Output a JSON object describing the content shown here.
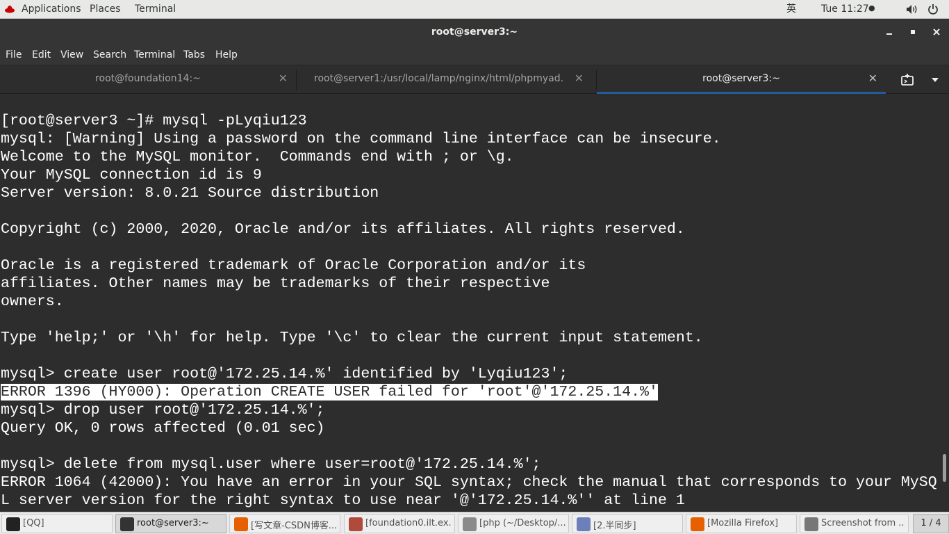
{
  "topbar": {
    "applications": "Applications",
    "places": "Places",
    "terminal": "Terminal",
    "input_method": "英",
    "clock": "Tue 11:27",
    "volume_icon": "speaker-icon",
    "power_icon": "power-icon"
  },
  "window": {
    "title": "root@server3:~",
    "minimize": "—",
    "maximize": "▪",
    "close": "✕"
  },
  "menu": {
    "file": "File",
    "edit": "Edit",
    "view": "View",
    "search": "Search",
    "terminal": "Terminal",
    "tabs": "Tabs",
    "help": "Help"
  },
  "tabs": [
    {
      "label": "root@foundation14:~"
    },
    {
      "label": "root@server1:/usr/local/lamp/nginx/html/phpmyad..."
    },
    {
      "label": "root@server3:~"
    }
  ],
  "terminal_lines": [
    "[root@server3 ~]# mysql -pLyqiu123",
    "mysql: [Warning] Using a password on the command line interface can be insecure.",
    "Welcome to the MySQL monitor.  Commands end with ; or \\g.",
    "Your MySQL connection id is 9",
    "Server version: 8.0.21 Source distribution",
    "",
    "Copyright (c) 2000, 2020, Oracle and/or its affiliates. All rights reserved.",
    "",
    "Oracle is a registered trademark of Oracle Corporation and/or its",
    "affiliates. Other names may be trademarks of their respective",
    "owners.",
    "",
    "Type 'help;' or '\\h' for help. Type '\\c' to clear the current input statement.",
    "",
    "mysql> create user root@'172.25.14.%' identified by 'Lyqiu123';",
    "ERROR 1396 (HY000): Operation CREATE USER failed for 'root'@'172.25.14.%'",
    "mysql> drop user root@'172.25.14.%';",
    "Query OK, 0 rows affected (0.01 sec)",
    "",
    "mysql> delete from mysql.user where user=root@'172.25.14.%';",
    "ERROR 1064 (42000): You have an error in your SQL syntax; check the manual that corresponds to your MySQ",
    "L server version for the right syntax to use near '@'172.25.14.%'' at line 1"
  ],
  "highlighted_line": 15,
  "taskbar": {
    "tasks": [
      {
        "label": "[QQ]",
        "icon": "qq-penguin-icon",
        "color": "#222222"
      },
      {
        "label": "root@server3:~",
        "icon": "terminal-icon",
        "color": "#333333"
      },
      {
        "label": "[写文章-CSDN博客...",
        "icon": "firefox-icon",
        "color": "#e66000"
      },
      {
        "label": "[foundation0.ilt.ex...",
        "icon": "remote-viewer-icon",
        "color": "#b04a3a"
      },
      {
        "label": "[php (~/Desktop/...",
        "icon": "text-editor-icon",
        "color": "#8a8a8a"
      },
      {
        "label": "[2.半同步]",
        "icon": "document-icon",
        "color": "#6c7fb8"
      },
      {
        "label": "[Mozilla Firefox]",
        "icon": "firefox-icon",
        "color": "#e66000"
      },
      {
        "label": "Screenshot from ...",
        "icon": "screenshot-icon",
        "color": "#777777"
      }
    ],
    "pager": "1 / 4"
  }
}
